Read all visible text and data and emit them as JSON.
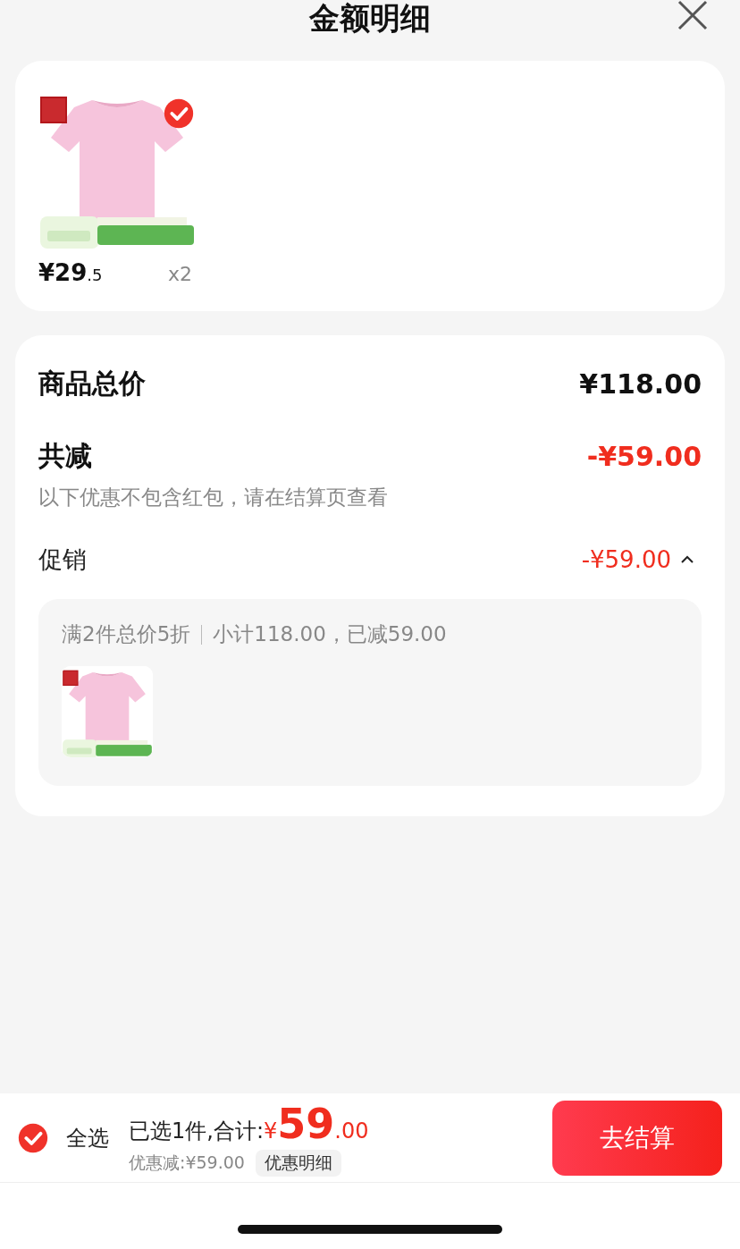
{
  "header": {
    "title": "金额明细"
  },
  "items": [
    {
      "kind": "picture",
      "selected": true,
      "price_int": "¥29",
      "price_dec": ".5",
      "quantity": "x2"
    }
  ],
  "total": {
    "label": "商品总价",
    "value": "¥118.00"
  },
  "discount": {
    "label": "共减",
    "value": "-¥59.00",
    "note": "以下优惠不包含红包，请在结算页查看"
  },
  "promotion": {
    "label": "促销",
    "value": "-¥59.00",
    "expanded": true,
    "rule": "满2件总价5折",
    "subtotal": "小计118.00，已减59.00"
  },
  "footer": {
    "select_all": {
      "label": "全选",
      "checked": true
    },
    "selected_count": "已选1件,合计:",
    "currency": "¥",
    "amount_int": "59",
    "amount_dec": ".00",
    "saving": "优惠减:¥59.00",
    "details": "优惠明细",
    "checkout": "去结算"
  }
}
